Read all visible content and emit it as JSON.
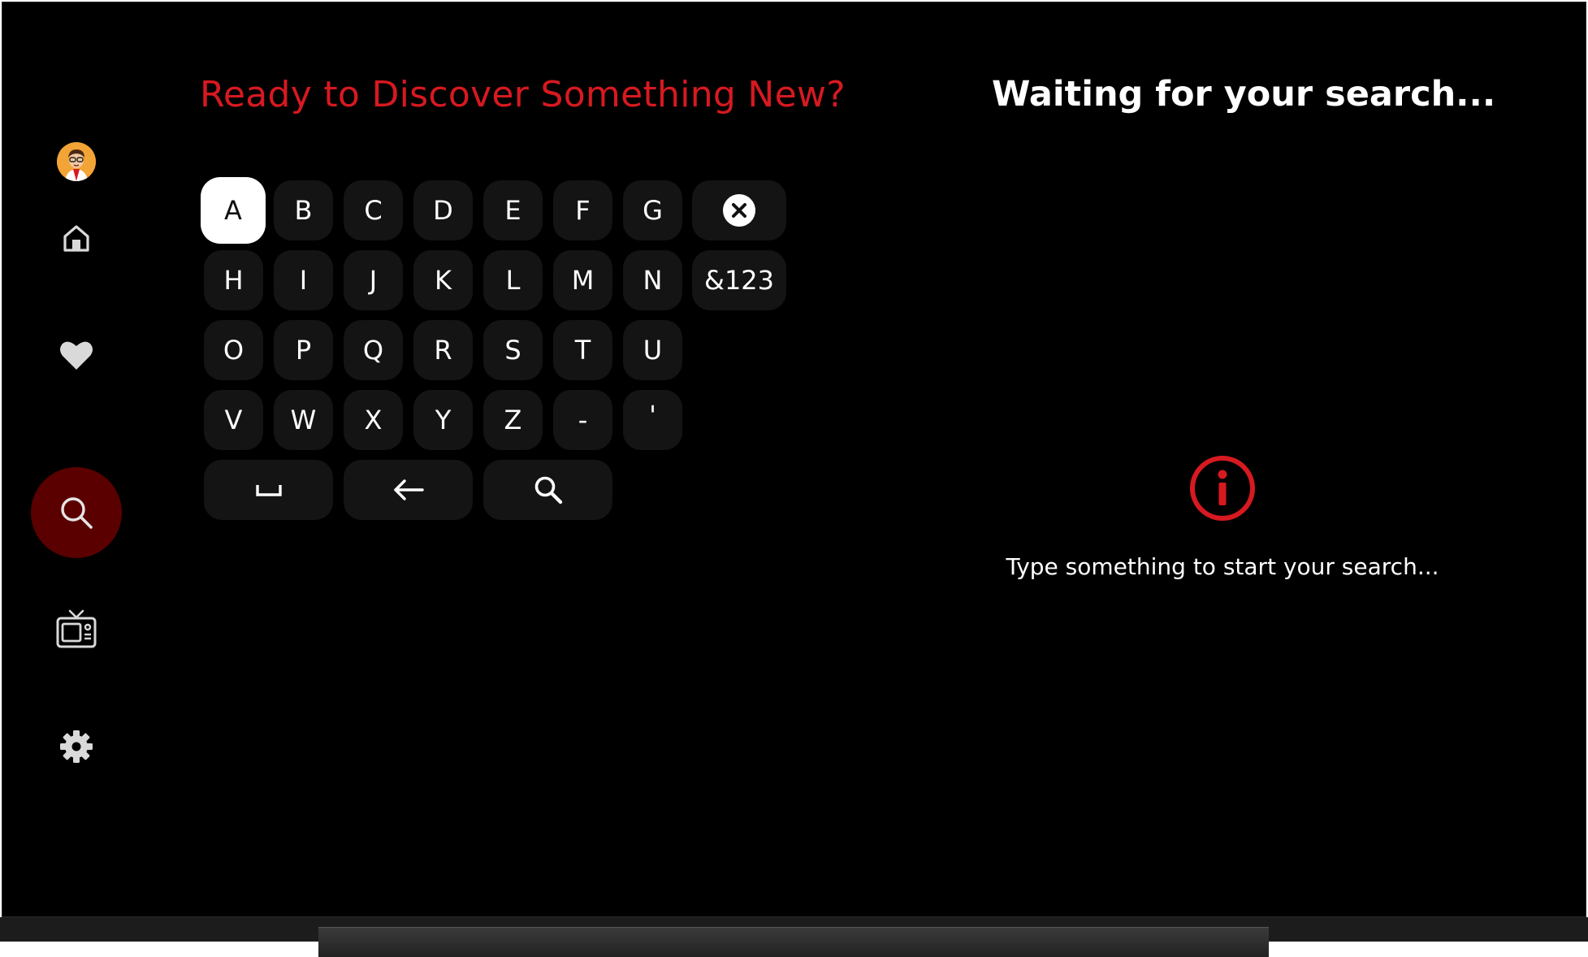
{
  "header": {
    "headline": "Ready to Discover Something New?",
    "results_title": "Waiting for your search..."
  },
  "sidebar": {
    "items": [
      {
        "name": "avatar",
        "icon": "avatar-icon"
      },
      {
        "name": "home",
        "icon": "home-icon"
      },
      {
        "name": "favorites",
        "icon": "heart-icon"
      },
      {
        "name": "search",
        "icon": "search-icon",
        "active": true
      },
      {
        "name": "live-tv",
        "icon": "tv-icon"
      },
      {
        "name": "settings",
        "icon": "gear-icon"
      }
    ]
  },
  "keyboard": {
    "selected_key": "A",
    "rows": [
      [
        "A",
        "B",
        "C",
        "D",
        "E",
        "F",
        "G"
      ],
      [
        "H",
        "I",
        "J",
        "K",
        "L",
        "M",
        "N"
      ],
      [
        "O",
        "P",
        "Q",
        "R",
        "S",
        "T",
        "U"
      ],
      [
        "V",
        "W",
        "X",
        "Y",
        "Z",
        "-",
        "'"
      ]
    ],
    "clear_icon": "close-circle-icon",
    "symbols_label": "&123",
    "space_icon": "space-bar-icon",
    "backspace_icon": "arrow-left-icon",
    "submit_icon": "search-icon"
  },
  "empty_state": {
    "icon": "info-icon",
    "message": "Type something to start your search..."
  },
  "colors": {
    "accent": "#d71920",
    "active_nav": "#5a0000",
    "key_bg": "#141414",
    "background": "#000000"
  }
}
